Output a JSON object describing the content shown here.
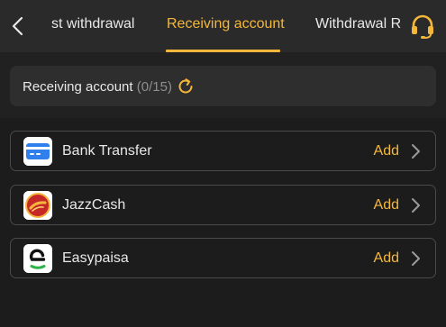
{
  "header": {
    "tabs": [
      {
        "label": "st withdrawal",
        "active": false
      },
      {
        "label": "Receiving account",
        "active": true
      },
      {
        "label": "Withdrawal R",
        "active": false
      }
    ]
  },
  "account_panel": {
    "label": "Receiving account",
    "count": "(0/15)"
  },
  "methods": [
    {
      "name": "Bank Transfer",
      "action": "Add",
      "icon": "bank-card-icon"
    },
    {
      "name": "JazzCash",
      "action": "Add",
      "icon": "jazzcash-logo"
    },
    {
      "name": "Easypaisa",
      "action": "Add",
      "icon": "easypaisa-logo"
    }
  ],
  "colors": {
    "accent": "#f4b73b",
    "background": "#212121",
    "panel": "#2e2e2e",
    "bank_blue": "#2f80ed",
    "jazz_red": "#c62828",
    "easypaisa_green": "#2fb24a"
  }
}
